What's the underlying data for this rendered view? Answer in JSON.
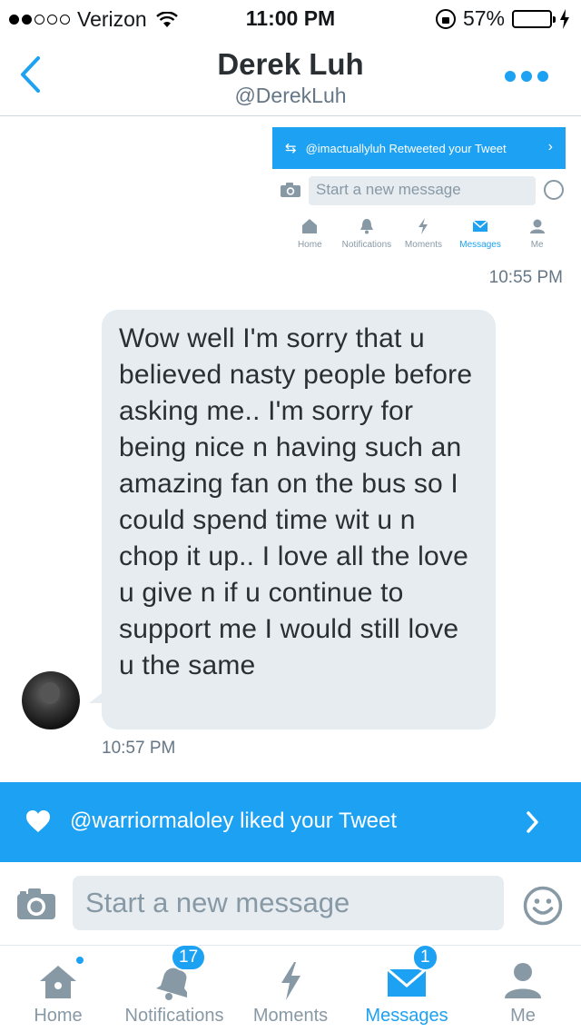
{
  "status_bar": {
    "carrier": "Verizon",
    "time": "11:00 PM",
    "battery_percent": "57%",
    "signal_bars_filled": 2,
    "signal_bars_total": 5
  },
  "header": {
    "name": "Derek Luh",
    "handle": "@DerekLuh",
    "back_icon": "chevron-left-icon",
    "more_icon": "more-dots-icon"
  },
  "attached_screenshot": {
    "banner_text": "@imactuallyluh Retweeted your Tweet",
    "compose_placeholder": "Start a new message",
    "tabs": [
      {
        "label": "Home"
      },
      {
        "label": "Notifications"
      },
      {
        "label": "Moments"
      },
      {
        "label": "Messages"
      },
      {
        "label": "Me"
      }
    ],
    "timestamp": "10:55 PM"
  },
  "message": {
    "text": "Wow well I'm sorry that u believed nasty people before asking me.. I'm sorry for being nice n having such an amazing fan on the bus so I could spend time wit u n chop it up.. I love all the love u give n if u continue to support me I would still love u the same",
    "timestamp": "10:57 PM"
  },
  "notification_banner": {
    "text": "@warriormaloley liked your Tweet",
    "icon": "heart-icon"
  },
  "compose": {
    "placeholder": "Start a new message",
    "value": ""
  },
  "tabbar": {
    "home": {
      "label": "Home"
    },
    "notifications": {
      "label": "Notifications",
      "badge": "17"
    },
    "moments": {
      "label": "Moments"
    },
    "messages": {
      "label": "Messages",
      "badge": "1"
    },
    "me": {
      "label": "Me"
    }
  },
  "colors": {
    "accent": "#1da1f2",
    "bubble": "#e6ecf0",
    "muted": "#8899a6",
    "battery": "#f5c518"
  }
}
